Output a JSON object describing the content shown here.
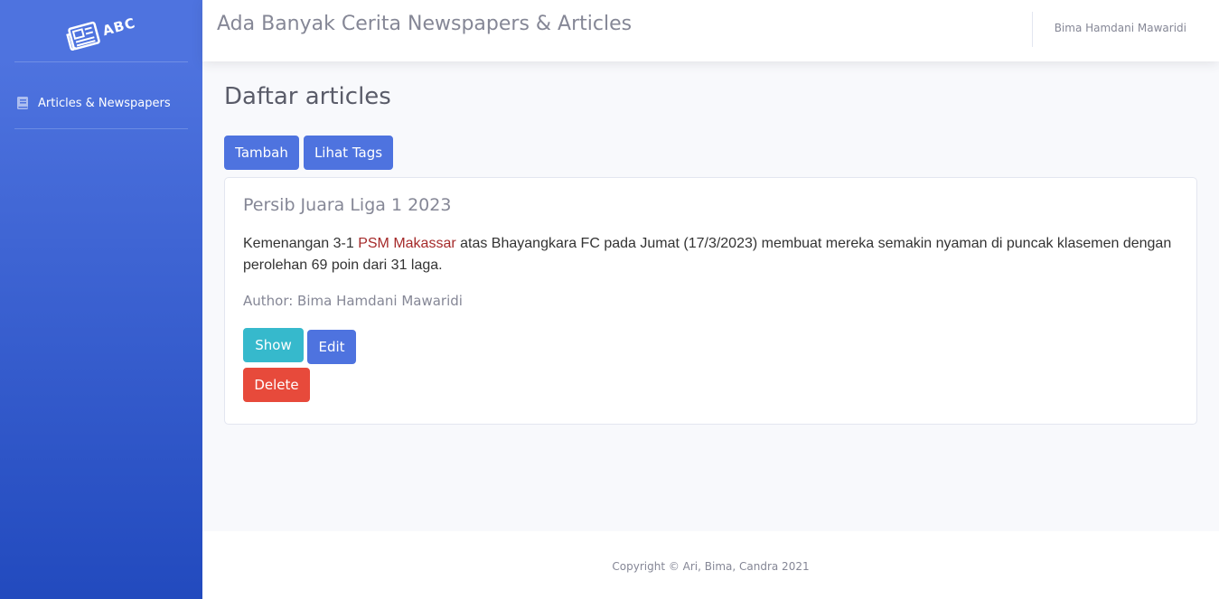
{
  "sidebar": {
    "brand_text": "ABC",
    "brand_icon": "newspaper-icon",
    "items": [
      {
        "label": "Articles & Newspapers",
        "icon": "book-icon"
      }
    ]
  },
  "topbar": {
    "title": "Ada Banyak Cerita Newspapers & Articles",
    "user_name": "Bima Hamdani Mawaridi"
  },
  "main": {
    "heading": "Daftar articles",
    "actions": {
      "add_label": "Tambah",
      "tags_label": "Lihat Tags"
    },
    "articles": [
      {
        "title": "Persib Juara Liga 1 2023",
        "body_before": "Kemenangan 3-1 ",
        "body_team": "PSM Makassar",
        "body_after": " atas Bhayangkara FC pada Jumat (17/3/2023) membuat mereka semakin nyaman di puncak klasemen dengan perolehan 69 poin dari 31 laga.",
        "author": "Author: Bima Hamdani Mawaridi",
        "show_label": "Show",
        "edit_label": "Edit",
        "delete_label": "Delete"
      }
    ]
  },
  "footer": {
    "copyright": "Copyright © Ari, Bima, Candra 2021"
  },
  "colors": {
    "primary": "#4e73df",
    "info": "#36b9cc",
    "danger": "#e74a3b",
    "sidebar_gradient_end": "#224abe",
    "highlight_text": "#a52a2a"
  }
}
